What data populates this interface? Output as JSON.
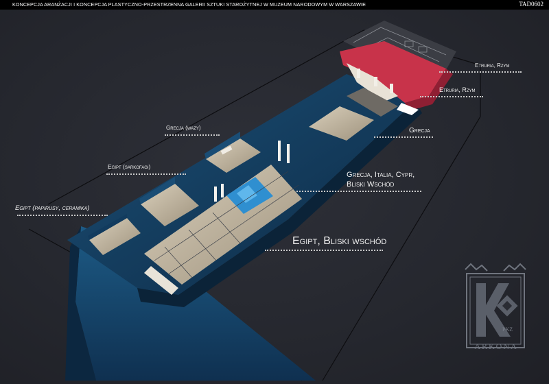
{
  "header": {
    "title": "Koncepcja aranżacji i koncepcja plastyczno-przestrzenna galerii sztuki starożytnej w Muzeum Narodowym w Warszawie",
    "code": "TAD0602"
  },
  "labels": {
    "etruria_rzym_top": "Etruria, Rzym",
    "etruria_rzym": "Etruria, Rzym",
    "grecja": "Grecja",
    "grecja_wazy": "Grecja (wazy)",
    "egipt_sarkofagi": "Egipt (sarkofagi)",
    "grecja_italia_line1": "Grecja, Italia, Cypr,",
    "grecja_italia_line2": "Bliski Wschód",
    "egipt_papirusy": "Egipt (papirusy, ceramika)",
    "egipt_bliski": "Egipt, Bliski wschód"
  },
  "logo": {
    "monogram": "K",
    "initials": "PKZ",
    "word": "ARKONA"
  },
  "colors": {
    "background": "#25272e",
    "building_blue": "#1e5f8a",
    "floor": "#cbbfa8",
    "etruria_red": "#c8334a",
    "pool": "#2f8fd0",
    "label": "#f2f2f2"
  }
}
